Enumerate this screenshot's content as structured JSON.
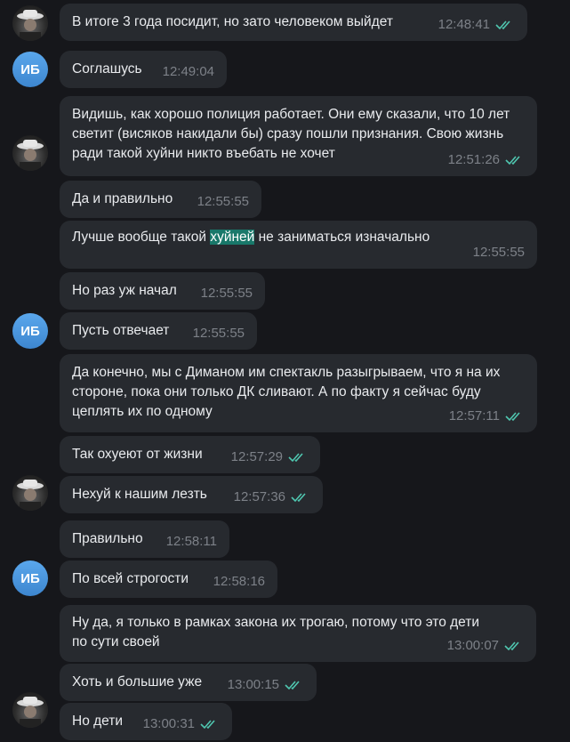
{
  "colors": {
    "background": "#16171b",
    "bubble": "#272a2f",
    "timestamp": "#7d8188",
    "read_check": "#4fc7b0",
    "avatar_initials_bg": "#4a97e0",
    "search_highlight": "#19786a"
  },
  "contacts": {
    "initials": "ИБ"
  },
  "messages": [
    {
      "text": "В итоге 3 года посидит, но зато человеком выйдет",
      "time": "12:48:41",
      "read": true
    },
    {
      "text": "Соглашусь",
      "time": "12:49:04",
      "read": false
    },
    {
      "text": "Видишь, как хорошо полиция работает. Они ему сказали, что 10 лет светит (висяков накидали бы) сразу пошли признания. Свою жизнь ради такой хуйни никто въебать не хочет",
      "time": "12:51:26",
      "read": true
    },
    {
      "text": "Да и правильно",
      "time": "12:55:55",
      "read": false
    },
    {
      "text_before": "Лучше вообще такой ",
      "highlight": "хуйней",
      "text_after": " не заниматься изначально",
      "time": "12:55:55",
      "read": false
    },
    {
      "text": "Но раз уж начал",
      "time": "12:55:55",
      "read": false
    },
    {
      "text": "Пусть отвечает",
      "time": "12:55:55",
      "read": false
    },
    {
      "text": "Да конечно, мы с Диманом им спектакль разыгрываем, что я на их стороне, пока они только ДК сливают. А по факту я сейчас буду цеплять их по одному",
      "time": "12:57:11",
      "read": true
    },
    {
      "text": "Так охуеют от жизни",
      "time": "12:57:29",
      "read": true
    },
    {
      "text": "Нехуй к нашим лезть",
      "time": "12:57:36",
      "read": true
    },
    {
      "text": "Правильно",
      "time": "12:58:11",
      "read": false
    },
    {
      "text": "По всей строгости",
      "time": "12:58:16",
      "read": false
    },
    {
      "text": "Ну да, я только в рамках закона их трогаю, потому что это дети по сути своей",
      "time": "13:00:07",
      "read": true
    },
    {
      "text": "Хоть и большие уже",
      "time": "13:00:15",
      "read": true
    },
    {
      "text": "Но дети",
      "time": "13:00:31",
      "read": true
    }
  ]
}
